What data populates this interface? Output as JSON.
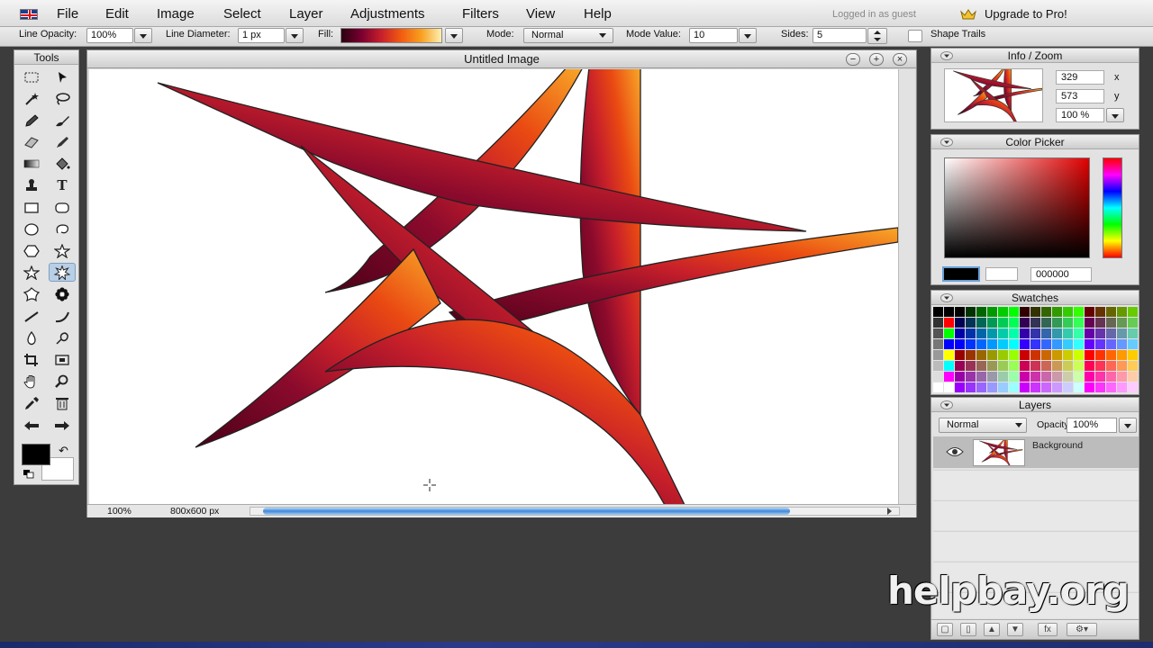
{
  "menubar": {
    "items": [
      "File",
      "Edit",
      "Image",
      "Select",
      "Layer",
      "Adjustments",
      "Filters",
      "View",
      "Help"
    ],
    "status": "Logged in as guest",
    "upgrade": "Upgrade to Pro!"
  },
  "options": {
    "line_opacity_label": "Line Opacity:",
    "line_opacity": "100%",
    "line_diameter_label": "Line Diameter:",
    "line_diameter": "1 px",
    "fill_label": "Fill:",
    "mode_label": "Mode:",
    "mode": "Normal",
    "mode_value_label": "Mode Value:",
    "mode_value": "10",
    "sides_label": "Sides:",
    "sides": "5",
    "shape_trails": "Shape Trails"
  },
  "tools": {
    "title": "Tools"
  },
  "document": {
    "title": "Untitled Image",
    "zoom": "100%",
    "size": "800x600 px"
  },
  "info": {
    "title": "Info / Zoom",
    "x": "329",
    "y": "573",
    "x_label": "x",
    "y_label": "y",
    "zoom": "100 %"
  },
  "picker": {
    "title": "Color Picker",
    "hex": "000000"
  },
  "swatches": {
    "title": "Swatches"
  },
  "layers": {
    "title": "Layers",
    "blend": "Normal",
    "opacity_label": "Opacity:",
    "opacity": "100%",
    "layer_name": "Background"
  },
  "watermark": "helpbay.org",
  "colors": {
    "accent": "#3f88d8",
    "fill_dark": "#7a0030",
    "fill_light": "#f8a020"
  }
}
